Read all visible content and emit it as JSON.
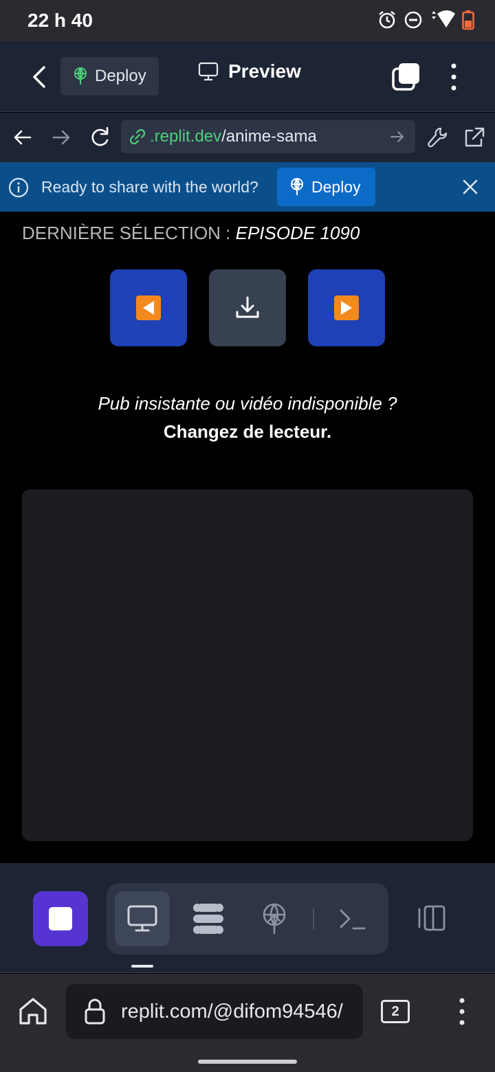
{
  "status_bar": {
    "time": "22 h 40",
    "icons": [
      "alarm-icon",
      "dnd-icon",
      "wifi-icon",
      "battery-icon"
    ]
  },
  "replit_header": {
    "deploy_tab_label": "Deploy",
    "preview_label": "Preview",
    "icons": [
      "back-chevron-icon",
      "deploy-icon",
      "monitor-icon",
      "tabs-icon",
      "more-vertical-icon"
    ]
  },
  "url_bar": {
    "domain": ".replit.dev",
    "path": "/anime-sama",
    "icons": [
      "arrow-left-icon",
      "arrow-right-icon",
      "reload-icon",
      "link-icon",
      "arrow-go-icon",
      "wrench-icon",
      "external-link-icon"
    ]
  },
  "banner": {
    "text": "Ready to share with the world?",
    "deploy_label": "Deploy",
    "colors": {
      "background": "#0b4f8a",
      "button": "#0d6bc8"
    }
  },
  "content": {
    "last_selection_label": "DERNIÈRE SÉLECTION : ",
    "last_selection_value": "EPISODE 1090",
    "controls": [
      "previous-episode",
      "download",
      "next-episode"
    ],
    "hint_question": "Pub insistante ou vidéo indisponible ?",
    "hint_action": "Changez de lecteur.",
    "colors": {
      "nav_button": "#1f41b5",
      "download_button": "#374151",
      "player_bg": "#1c1c21"
    }
  },
  "replit_toolbar": {
    "tools": [
      "webview-icon",
      "packages-icon",
      "deployments-icon",
      "shell-icon"
    ],
    "active_tool": "webview-icon",
    "colors": {
      "stop": "#5634d1"
    }
  },
  "browser_bar": {
    "url": "replit.com/@difom94546/",
    "tab_count": "2"
  }
}
